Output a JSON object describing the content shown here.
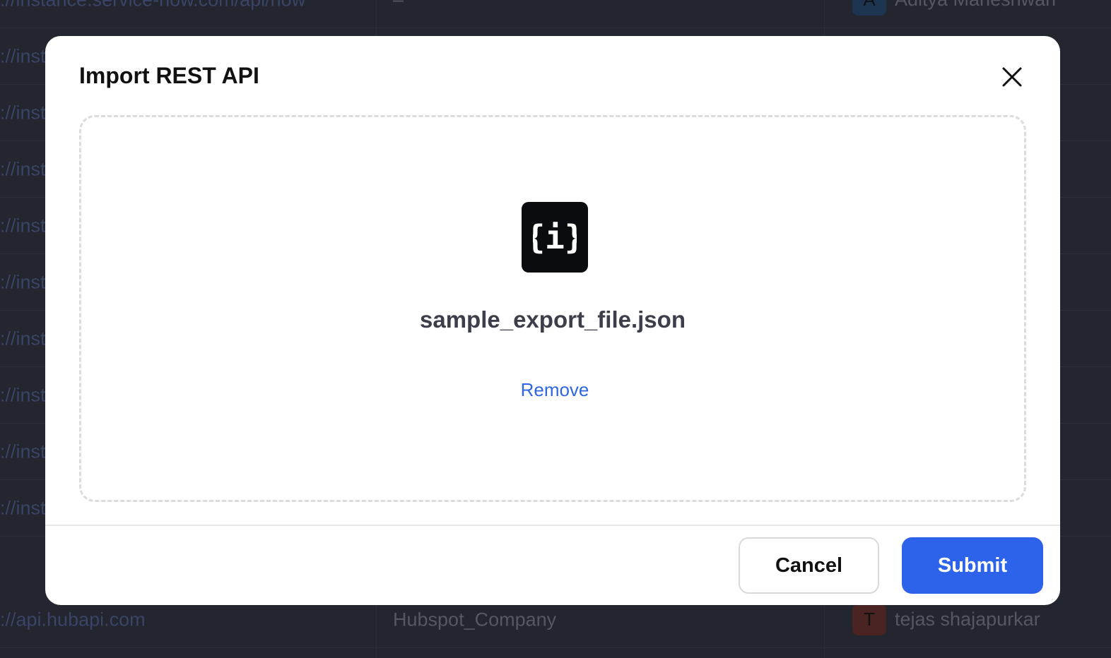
{
  "background_table": {
    "rows": [
      {
        "url": "://instance.service-now.com/api/now",
        "name": "–",
        "owner_initial": "A",
        "owner": "Aditya Maheshwari",
        "avatar_color": "#1d3550"
      },
      {
        "url": "://inst",
        "name": "",
        "owner_initial": "",
        "owner": ""
      },
      {
        "url": "://inst",
        "name": "",
        "owner_initial": "",
        "owner": ""
      },
      {
        "url": "://inst",
        "name": "",
        "owner_initial": "",
        "owner": ""
      },
      {
        "url": "://inst",
        "name": "",
        "owner_initial": "",
        "owner": ""
      },
      {
        "url": "://inst",
        "name": "",
        "owner_initial": "",
        "owner": ""
      },
      {
        "url": "://inst",
        "name": "",
        "owner_initial": "",
        "owner": ""
      },
      {
        "url": "://inst",
        "name": "",
        "owner_initial": "",
        "owner": ""
      },
      {
        "url": "://inst",
        "name": "",
        "owner_initial": "",
        "owner": ""
      },
      {
        "url": "://inst",
        "name": "",
        "owner_initial": "",
        "owner": ""
      },
      {
        "url": "://api.hubapi.com",
        "name": "Hubspot_Company",
        "owner_initial": "T",
        "owner": "tejas shajapurkar",
        "avatar_color": "#4a2323"
      }
    ]
  },
  "modal": {
    "title": "Import REST API",
    "close_icon": "close-icon",
    "file": {
      "icon": "json-file-icon",
      "icon_glyph": "{i}",
      "name": "sample_export_file.json"
    },
    "remove_label": "Remove",
    "cancel_label": "Cancel",
    "submit_label": "Submit"
  },
  "colors": {
    "accent": "#2d63ea",
    "link": "#2f66e4",
    "backdrop": "#23252f"
  }
}
